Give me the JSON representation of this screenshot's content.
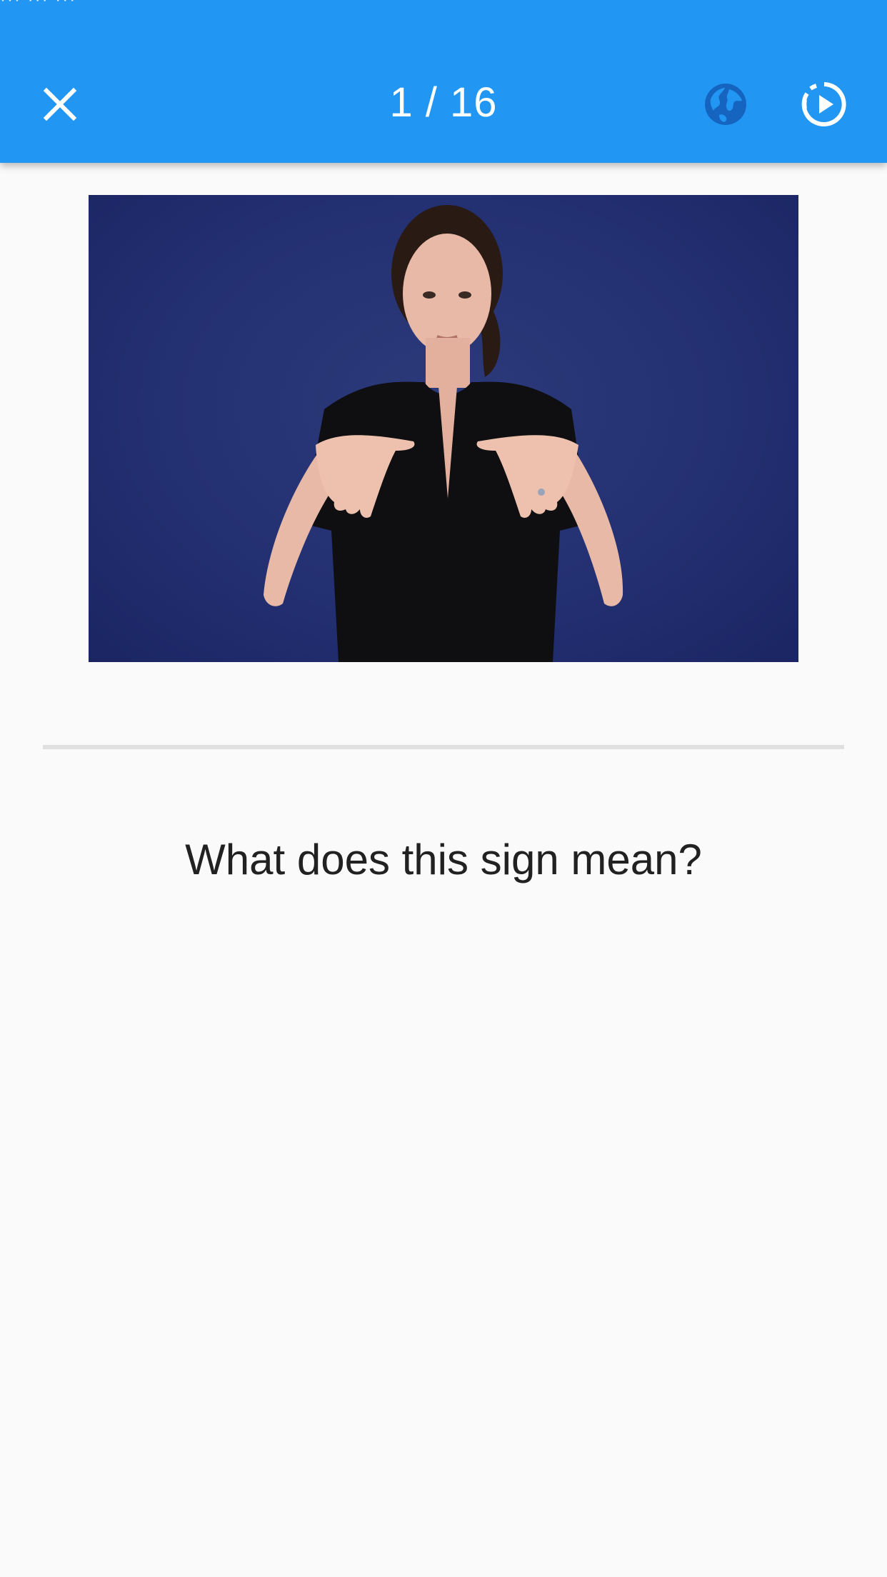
{
  "status_bar": {
    "text": "··· ··· ···"
  },
  "app_bar": {
    "progress": "1 / 16",
    "background_color": "#2196f3",
    "icons": {
      "close": "close-icon",
      "language": "globe-icon",
      "autoplay": "autoplay-icon"
    }
  },
  "question": {
    "text": "What does this sign mean?"
  }
}
